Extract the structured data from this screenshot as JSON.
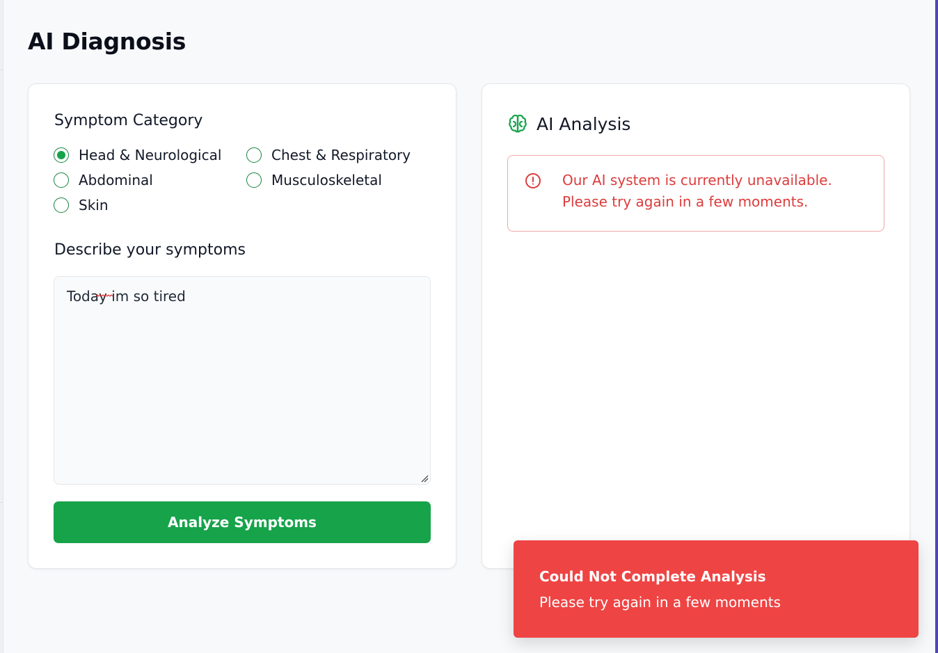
{
  "page": {
    "title": "AI Diagnosis"
  },
  "symptom_form": {
    "category_label": "Symptom Category",
    "categories": [
      {
        "label": "Head & Neurological",
        "checked": true
      },
      {
        "label": "Chest & Respiratory",
        "checked": false
      },
      {
        "label": "Abdominal",
        "checked": false
      },
      {
        "label": "Musculoskeletal",
        "checked": false
      },
      {
        "label": "Skin",
        "checked": false
      }
    ],
    "describe_label": "Describe your symptoms",
    "symptoms_value": "Today im so tired",
    "analyze_button": "Analyze Symptoms"
  },
  "analysis": {
    "title": "AI Analysis",
    "icon": "brain-icon",
    "error_icon": "alert-circle-icon",
    "error_message": "Our AI system is currently unavailable. Please try again in a few moments."
  },
  "toast": {
    "title": "Could Not Complete Analysis",
    "message": "Please try again in a few moments"
  },
  "colors": {
    "accent_green": "#16a34a",
    "error_red": "#ef4444",
    "error_text": "#dc3c3c",
    "background": "#f8f9fb"
  }
}
